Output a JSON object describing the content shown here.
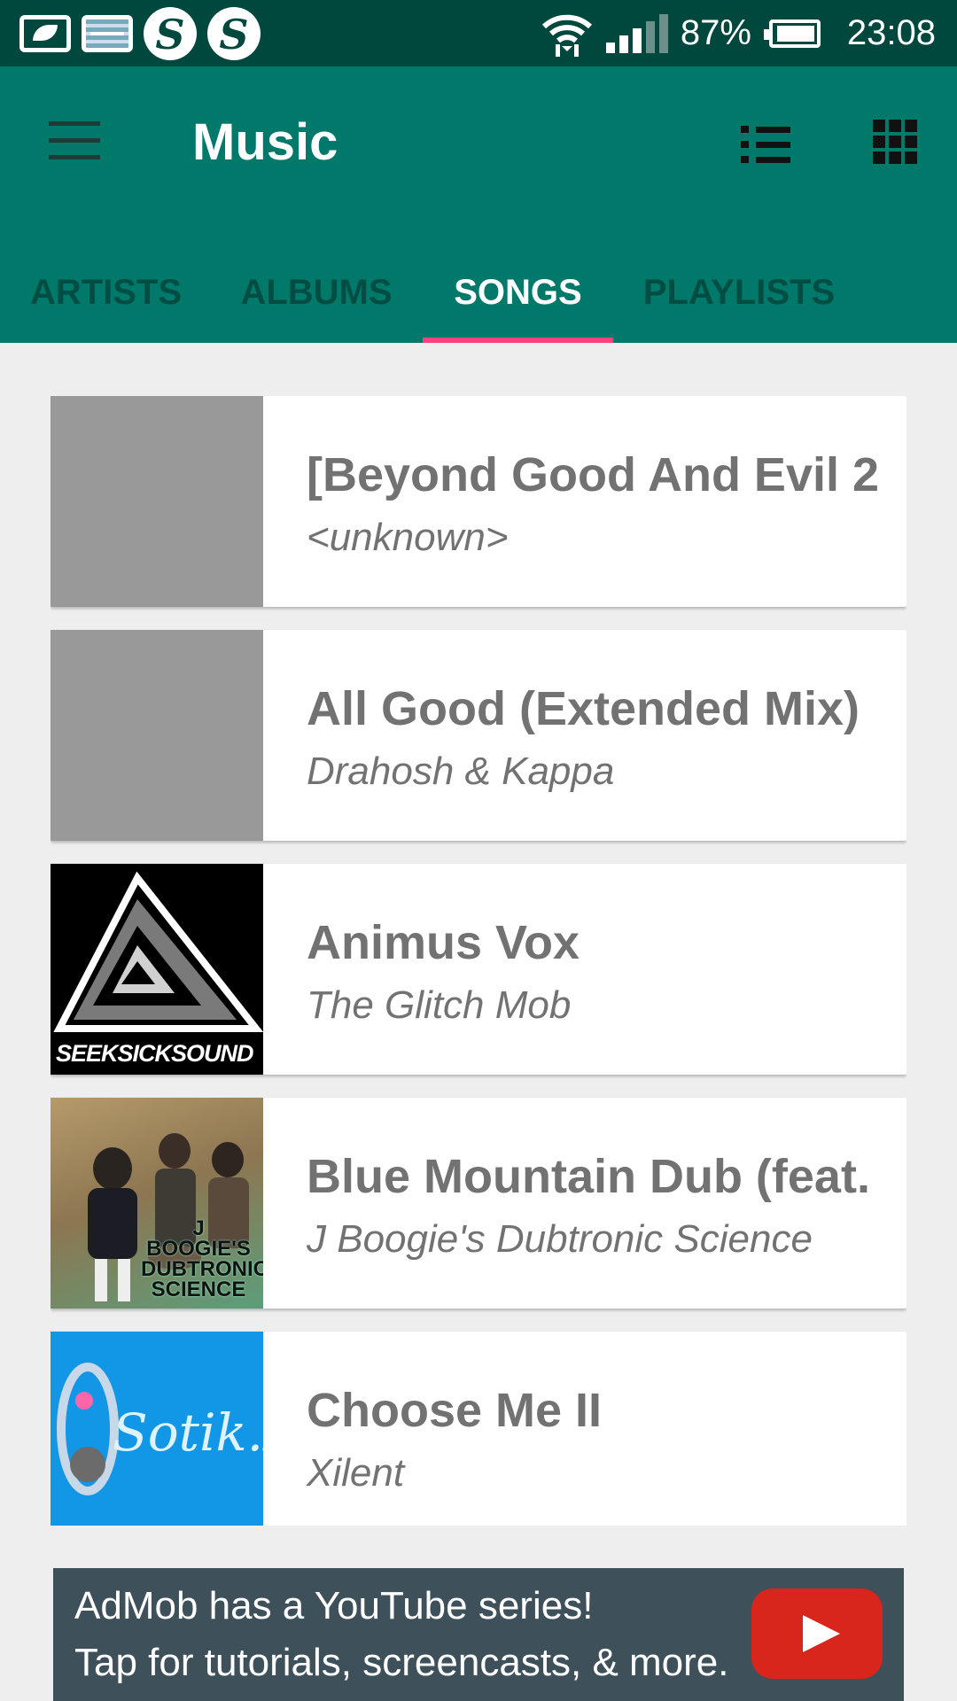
{
  "status_bar": {
    "battery": "87%",
    "time": "23:08"
  },
  "app_bar": {
    "title": "Music"
  },
  "tabs": [
    {
      "label": "ARTISTS"
    },
    {
      "label": "ALBUMS"
    },
    {
      "label": "SONGS",
      "active": true
    },
    {
      "label": "PLAYLISTS"
    }
  ],
  "songs": [
    {
      "title": "[Beyond Good And Evil 2",
      "artist": "<unknown>"
    },
    {
      "title": "All Good (Extended Mix)",
      "artist": "Drahosh & Kappa"
    },
    {
      "title": "Animus Vox",
      "artist": "The Glitch Mob",
      "art_text": "SEEKSICKSOUND"
    },
    {
      "title": "Blue Mountain Dub (feat.",
      "artist": "J Boogie's Dubtronic Science",
      "art_text": "J BOOGIE'S DUBTRONIC SCIENCE"
    },
    {
      "title": "Choose Me II",
      "artist": "Xilent",
      "art_text": "Sotik.Ru"
    }
  ],
  "ad": {
    "line1": "AdMob has a YouTube series!",
    "line2": "Tap for tutorials, screencasts, & more."
  },
  "colors": {
    "status_bar": "#00483e",
    "app_bar": "#00796b",
    "tab_indicator": "#ff4081"
  }
}
